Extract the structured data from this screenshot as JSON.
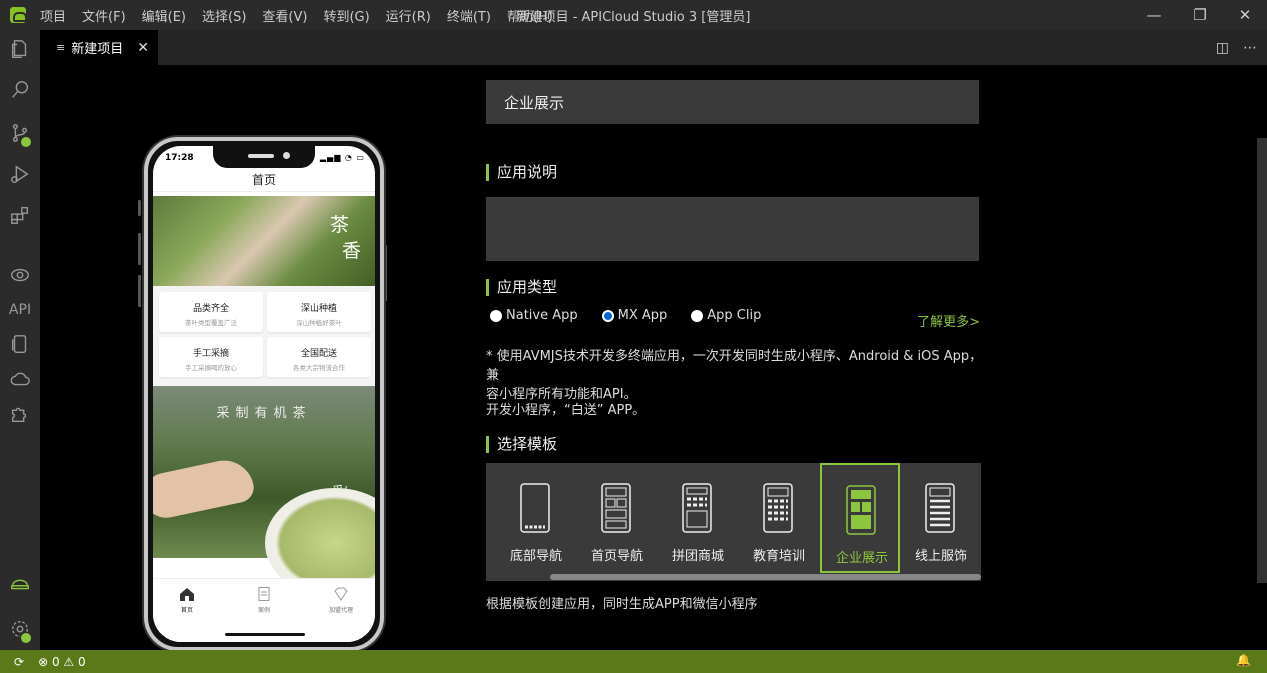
{
  "titlebar": {
    "menu": [
      "项目",
      "文件(F)",
      "编辑(E)",
      "选择(S)",
      "查看(V)",
      "转到(G)",
      "运行(R)",
      "终端(T)",
      "帮助(H)"
    ],
    "window_title": "新建项目 - APICloud Studio 3 [管理员]",
    "controls": {
      "minimize": "—",
      "restore": "❐",
      "close": "✕"
    }
  },
  "activitybar": {
    "items": [
      "explorer-icon",
      "search-icon",
      "source-control-icon",
      "run-debug-icon",
      "extensions-icon",
      "preview-icon",
      "API",
      "device-icon",
      "cloud-icon",
      "plugin-icon"
    ],
    "api_label": "API",
    "bottom": [
      "apicloud-icon",
      "settings-icon"
    ]
  },
  "tab": {
    "label": "新建项目",
    "icon": "≡",
    "close": "✕",
    "actions": {
      "split": "◫",
      "more": "⋯"
    }
  },
  "phone": {
    "time": "17:28",
    "status_icons": "▂▄▆ ◔ ▭",
    "title": "首页",
    "banner_chars": [
      "茶",
      "香"
    ],
    "cards": [
      {
        "title": "品类齐全",
        "sub": "茶叶类型覆盖广泛"
      },
      {
        "title": "深山种植",
        "sub": "深山种植好茶叶"
      },
      {
        "title": "手工采摘",
        "sub": "手工采摘喝的放心"
      },
      {
        "title": "全国配送",
        "sub": "各类大宗物流合作"
      }
    ],
    "banner2_title": "采制有机茶",
    "banner2_sig": "采/",
    "tabs": [
      {
        "label": "首页",
        "icon": "home-icon"
      },
      {
        "label": "案例",
        "icon": "document-icon"
      },
      {
        "label": "加盟代理",
        "icon": "gem-icon"
      }
    ]
  },
  "form": {
    "name_value": "企业展示",
    "desc_title": "应用说明",
    "desc_value": "",
    "type_title": "应用类型",
    "types": [
      {
        "label": "Native App",
        "checked": false
      },
      {
        "label": "MX App",
        "checked": true
      },
      {
        "label": "App Clip",
        "checked": false
      }
    ],
    "learn_more": "了解更多>",
    "note_line1": "* 使用AVMJS技术开发多终端应用，一次开发同时生成小程序、Android & iOS App，兼",
    "note_line2": "容小程序所有功能和API。",
    "note2": "开发小程序，“白送” APP。",
    "template_title": "选择模板",
    "templates": [
      {
        "label": "底部导航",
        "selected": false
      },
      {
        "label": "首页导航",
        "selected": false
      },
      {
        "label": "拼团商城",
        "selected": false
      },
      {
        "label": "教育培训",
        "selected": false
      },
      {
        "label": "企业展示",
        "selected": true
      },
      {
        "label": "线上服饰",
        "selected": false
      }
    ],
    "footnote": "根据模板创建应用，同时生成APP和微信小程序"
  },
  "statusbar": {
    "errors": "0",
    "warnings": "0",
    "error_icon": "⊗",
    "warning_icon": "⚠",
    "sync_icon": "⟳",
    "bell_icon": "🔔"
  },
  "colors": {
    "accent": "#8cc63f",
    "statusbar": "#5a7a1a",
    "panel": "#3a3a3a",
    "radio_on": "#0a64d6"
  }
}
